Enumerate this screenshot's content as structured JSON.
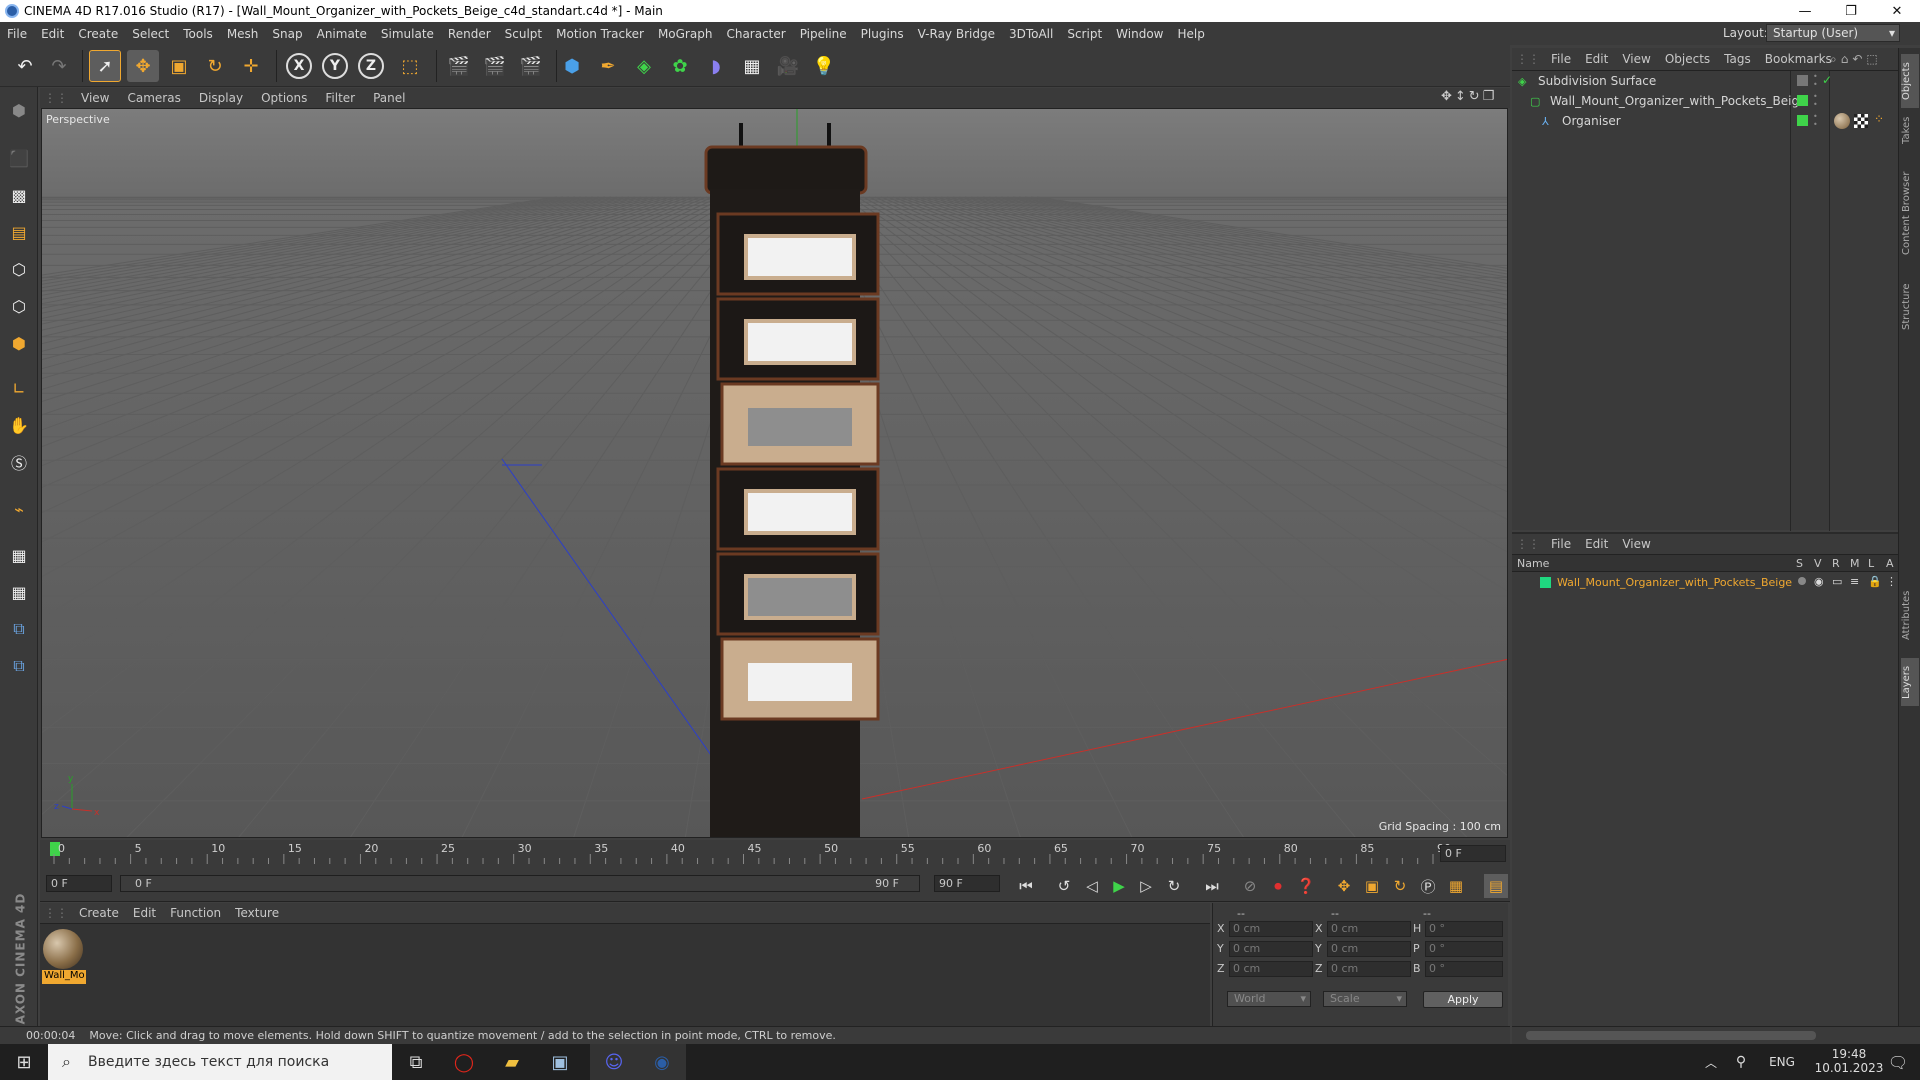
{
  "window": {
    "title": "CINEMA 4D R17.016 Studio (R17) - [Wall_Mount_Organizer_with_Pockets_Beige_c4d_standart.c4d *] - Main",
    "minimize": "—",
    "maximize": "❐",
    "close": "✕"
  },
  "menu": [
    "File",
    "Edit",
    "Create",
    "Select",
    "Tools",
    "Mesh",
    "Snap",
    "Animate",
    "Simulate",
    "Render",
    "Sculpt",
    "Motion Tracker",
    "MoGraph",
    "Character",
    "Pipeline",
    "Plugins",
    "V-Ray Bridge",
    "3DToAll",
    "Script",
    "Window",
    "Help"
  ],
  "layout": {
    "label": "Layout:",
    "value": "Startup (User)"
  },
  "toolbar": {
    "x": "X",
    "y": "Y",
    "z": "Z"
  },
  "viewport": {
    "menu": [
      "View",
      "Cameras",
      "Display",
      "Options",
      "Filter",
      "Panel"
    ],
    "label": "Perspective",
    "grid_spacing": "Grid Spacing : 100 cm"
  },
  "timeline": {
    "ticks": [
      "0",
      "5",
      "10",
      "15",
      "20",
      "25",
      "30",
      "35",
      "40",
      "45",
      "50",
      "55",
      "60",
      "65",
      "70",
      "75",
      "80",
      "85",
      "90"
    ],
    "current": "0 F",
    "start": "0 F",
    "range_start": "0 F",
    "range_end": "90 F",
    "end": "90 F"
  },
  "material": {
    "menu": [
      "Create",
      "Edit",
      "Function",
      "Texture"
    ],
    "items": [
      {
        "name": "Wall_Mo"
      }
    ]
  },
  "coords": {
    "headers": [
      "--",
      "--",
      "--"
    ],
    "rows": [
      {
        "a": "X",
        "av": "0 cm",
        "b": "X",
        "bv": "0 cm",
        "c": "H",
        "cv": "0 °"
      },
      {
        "a": "Y",
        "av": "0 cm",
        "b": "Y",
        "bv": "0 cm",
        "c": "P",
        "cv": "0 °"
      },
      {
        "a": "Z",
        "av": "0 cm",
        "b": "Z",
        "bv": "0 cm",
        "c": "B",
        "cv": "0 °"
      }
    ],
    "space": "World",
    "mode": "Scale",
    "apply": "Apply"
  },
  "status": {
    "time": "00:00:04",
    "message": "Move: Click and drag to move elements. Hold down SHIFT to quantize movement / add to the selection in point mode, CTRL to remove."
  },
  "objects": {
    "menu": [
      "File",
      "Edit",
      "View",
      "Objects",
      "Tags",
      "Bookmarks"
    ],
    "tree": [
      {
        "name": "Subdivision Surface",
        "indent": 0,
        "color": "#3fd34a"
      },
      {
        "name": "Wall_Mount_Organizer_with_Pockets_Beige",
        "indent": 1,
        "color": "#3fd34a"
      },
      {
        "name": "Organiser",
        "indent": 2,
        "color": "#3fd34a"
      }
    ]
  },
  "layers": {
    "menu": [
      "File",
      "Edit",
      "View"
    ],
    "header_name": "Name",
    "header_cols": [
      "S",
      "V",
      "R",
      "M",
      "L",
      "A"
    ],
    "items": [
      {
        "name": "Wall_Mount_Organizer_with_Pockets_Beige",
        "color": "#1fd880"
      }
    ]
  },
  "right_tabs": [
    "Objects",
    "Takes",
    "Content Browser",
    "Structure",
    "Attributes",
    "Layers"
  ],
  "brand": "MAXON CINEMA 4D",
  "taskbar": {
    "search_placeholder": "Введите здесь текст для поиска",
    "lang": "ENG",
    "time": "19:48",
    "date": "10.01.2023"
  },
  "colors": {
    "accent": "#f0a830",
    "active_green": "#3fd34a",
    "axis_red": "#c8302a",
    "axis_blue": "#2c3fc8",
    "axis_green": "#2aa02a"
  }
}
